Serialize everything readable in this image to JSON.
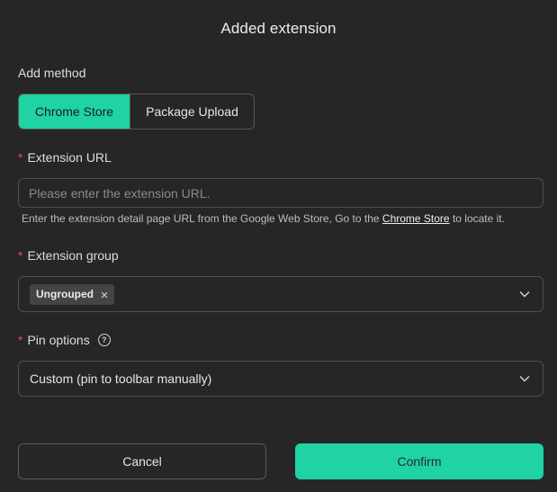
{
  "dialog": {
    "title": "Added extension"
  },
  "add_method": {
    "label": "Add method",
    "options": [
      "Chrome Store",
      "Package Upload"
    ],
    "selected": "Chrome Store"
  },
  "extension_url": {
    "required_mark": "*",
    "label": "Extension URL",
    "value": "",
    "placeholder": "Please enter the extension URL.",
    "hint_prefix": "Enter the extension detail page URL from the Google Web Store, Go to the ",
    "hint_link": "Chrome Store",
    "hint_suffix": " to locate it."
  },
  "extension_group": {
    "required_mark": "*",
    "label": "Extension group",
    "tags": [
      "Ungrouped"
    ]
  },
  "pin_options": {
    "required_mark": "*",
    "label": "Pin options",
    "help_glyph": "?",
    "value": "Custom (pin to toolbar manually)"
  },
  "footer": {
    "cancel_label": "Cancel",
    "confirm_label": "Confirm"
  },
  "colors": {
    "accent": "#1fd3a4",
    "required": "#e5484d",
    "background": "#262626"
  },
  "icons": {
    "tag_remove": "close-icon",
    "dropdown": "chevron-down-icon",
    "help": "question-circle-icon"
  }
}
